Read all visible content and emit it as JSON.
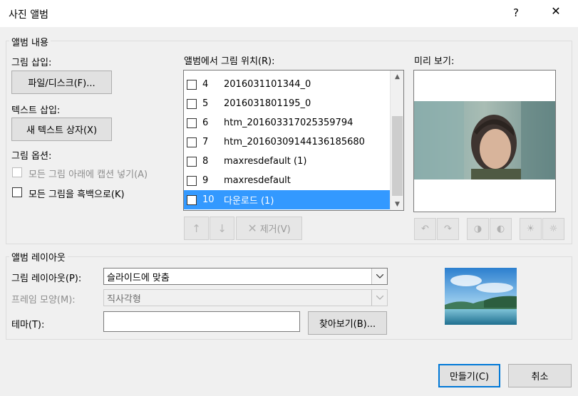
{
  "window": {
    "title": "사진 앨범",
    "help": "?",
    "close": "✕"
  },
  "album_content": {
    "legend": "앨범 내용",
    "insert_picture_label": "그림 삽입:",
    "file_disk_button": "파일/디스크(F)...",
    "insert_text_label": "텍스트 삽입:",
    "new_textbox_button": "새 텍스트 상자(X)",
    "picture_options_label": "그림 옵션:",
    "captions_below_all": "모든 그림 아래에 캡션 넣기(A)",
    "all_black_and_white": "모든 그림을 흑백으로(K)",
    "pictures_in_album_label": "앨범에서 그림 위치(R):",
    "list_items": [
      {
        "num": "4",
        "name": "2016031101344_0",
        "selected": false
      },
      {
        "num": "5",
        "name": "2016031801195_0",
        "selected": false
      },
      {
        "num": "6",
        "name": "htm_201603317025359794",
        "selected": false
      },
      {
        "num": "7",
        "name": "htm_20160309144136185680",
        "selected": false
      },
      {
        "num": "8",
        "name": "maxresdefault (1)",
        "selected": false
      },
      {
        "num": "9",
        "name": "maxresdefault",
        "selected": false
      },
      {
        "num": "10",
        "name": "다운로드 (1)",
        "selected": true
      }
    ],
    "remove_button": "제거(V)",
    "preview_label": "미리 보기:"
  },
  "album_layout": {
    "legend": "앨범 레이아웃",
    "picture_layout_label": "그림 레이아웃(P):",
    "picture_layout_value": "슬라이드에 맞춤",
    "frame_shape_label": "프레임 모양(M):",
    "frame_shape_value": "직사각형",
    "theme_label": "테마(T):",
    "theme_value": "",
    "browse_button": "찾아보기(B)..."
  },
  "footer": {
    "create_button": "만들기(C)",
    "cancel_button": "취소"
  },
  "colors": {
    "selection": "#3399ff",
    "focus_border": "#0078d7"
  },
  "icons": {
    "move_up": "arrow-up-icon",
    "move_down": "arrow-down-icon",
    "remove": "x-remove-icon",
    "rotate_left": "rotate-left-icon",
    "rotate_right": "rotate-right-icon",
    "contrast_more": "contrast-more-icon",
    "contrast_less": "contrast-less-icon",
    "brightness_more": "brightness-more-icon",
    "brightness_less": "brightness-less-icon"
  }
}
